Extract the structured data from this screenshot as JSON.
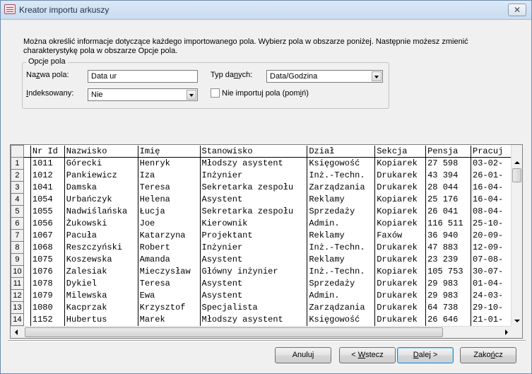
{
  "window": {
    "title": "Kreator importu arkuszy",
    "close_glyph": "✕"
  },
  "description": {
    "line1": "Można określić informacje dotyczące każdego importowanego pola. Wybierz pola w obszarze poniżej. Następnie możesz zmienić",
    "line2": "charakterystykę pola w obszarze Opcje pola."
  },
  "field_options": {
    "legend": "Opcje pola",
    "name_label_prefix": "Na",
    "name_label_access": "z",
    "name_label_suffix": "wa pola:",
    "name_value": "Data ur",
    "type_label_prefix": "Typ da",
    "type_label_access": "n",
    "type_label_suffix": "ych:",
    "type_value": "Data/Godzina",
    "indexed_label_access": "I",
    "indexed_label_suffix": "ndeksowany:",
    "indexed_value": "Nie",
    "skip_label_prefix": "Nie importuj pola (pom",
    "skip_label_access": "i",
    "skip_label_suffix": "ń)",
    "skip_checked": false
  },
  "grid": {
    "columns": [
      "Nr Id",
      "Nazwisko",
      "Imię",
      "Stanowisko",
      "Dział",
      "Sekcja",
      "Pensja",
      "Pracuj"
    ],
    "rows": [
      {
        "n": "1",
        "cells": [
          "1011",
          "Górecki",
          "Henryk",
          "Młodszy asystent",
          "Księgowość",
          "Kopiarek",
          "27 598",
          "03-02-"
        ]
      },
      {
        "n": "2",
        "cells": [
          "1012",
          "Pankiewicz",
          "Iza",
          "Inżynier",
          "Inż.-Techn.",
          "Drukarek",
          "43 394",
          "26-01-"
        ]
      },
      {
        "n": "3",
        "cells": [
          "1041",
          "Damska",
          "Teresa",
          "Sekretarka zespołu",
          "Zarządzania",
          "Drukarek",
          "28 044",
          "16-04-"
        ]
      },
      {
        "n": "4",
        "cells": [
          "1054",
          "Urbańczyk",
          "Helena",
          "Asystent",
          "Reklamy",
          "Kopiarek",
          "25 176",
          "16-04-"
        ]
      },
      {
        "n": "5",
        "cells": [
          "1055",
          "Nadwiślańska",
          "Łucja",
          "Sekretarka zespołu",
          "Sprzedaży",
          "Kopiarek",
          "26 041",
          "08-04-"
        ]
      },
      {
        "n": "6",
        "cells": [
          "1056",
          "Żukowski",
          "Joe",
          "Kierownik",
          "Admin.",
          "Kopiarek",
          "116 511",
          "25-10-"
        ]
      },
      {
        "n": "7",
        "cells": [
          "1067",
          "Pacuła",
          "Katarzyna",
          "Projektant",
          "Reklamy",
          "Faxów",
          "36 940",
          "20-09-"
        ]
      },
      {
        "n": "8",
        "cells": [
          "1068",
          "Reszczyński",
          "Robert",
          "Inżynier",
          "Inż.-Techn.",
          "Drukarek",
          "47 883",
          "12-09-"
        ]
      },
      {
        "n": "9",
        "cells": [
          "1075",
          "Koszewska",
          "Amanda",
          "Asystent",
          "Reklamy",
          "Drukarek",
          "23 239",
          "07-08-"
        ]
      },
      {
        "n": "10",
        "cells": [
          "1076",
          "Zalesiak",
          "Mieczysław",
          "Główny inżynier",
          "Inż.-Techn.",
          "Kopiarek",
          "105 753",
          "30-07-"
        ]
      },
      {
        "n": "11",
        "cells": [
          "1078",
          "Dykiel",
          "Teresa",
          "Asystent",
          "Sprzedaży",
          "Drukarek",
          "29 983",
          "01-04-"
        ]
      },
      {
        "n": "12",
        "cells": [
          "1079",
          "Milewska",
          "Ewa",
          "Asystent",
          "Admin.",
          "Drukarek",
          "29 983",
          "24-03-"
        ]
      },
      {
        "n": "13",
        "cells": [
          "1080",
          "Kacprzak",
          "Krzysztof",
          "Specjalista",
          "Zarządzania",
          "Drukarek",
          "64 738",
          "29-10-"
        ]
      },
      {
        "n": "14",
        "cells": [
          "1152",
          "Hubertus",
          "Marek",
          "Młodszy asystent",
          "Księgowość",
          "Drukarek",
          "26 646",
          "21-01-"
        ]
      }
    ]
  },
  "buttons": {
    "cancel": {
      "prefix": "Anuluj",
      "access": "",
      "suffix": ""
    },
    "back": {
      "prefix": "< ",
      "access": "W",
      "suffix": "stecz"
    },
    "next": {
      "prefix": "",
      "access": "D",
      "suffix": "alej >"
    },
    "finish": {
      "prefix": "Zako",
      "access": "ń",
      "suffix": "cz"
    }
  }
}
